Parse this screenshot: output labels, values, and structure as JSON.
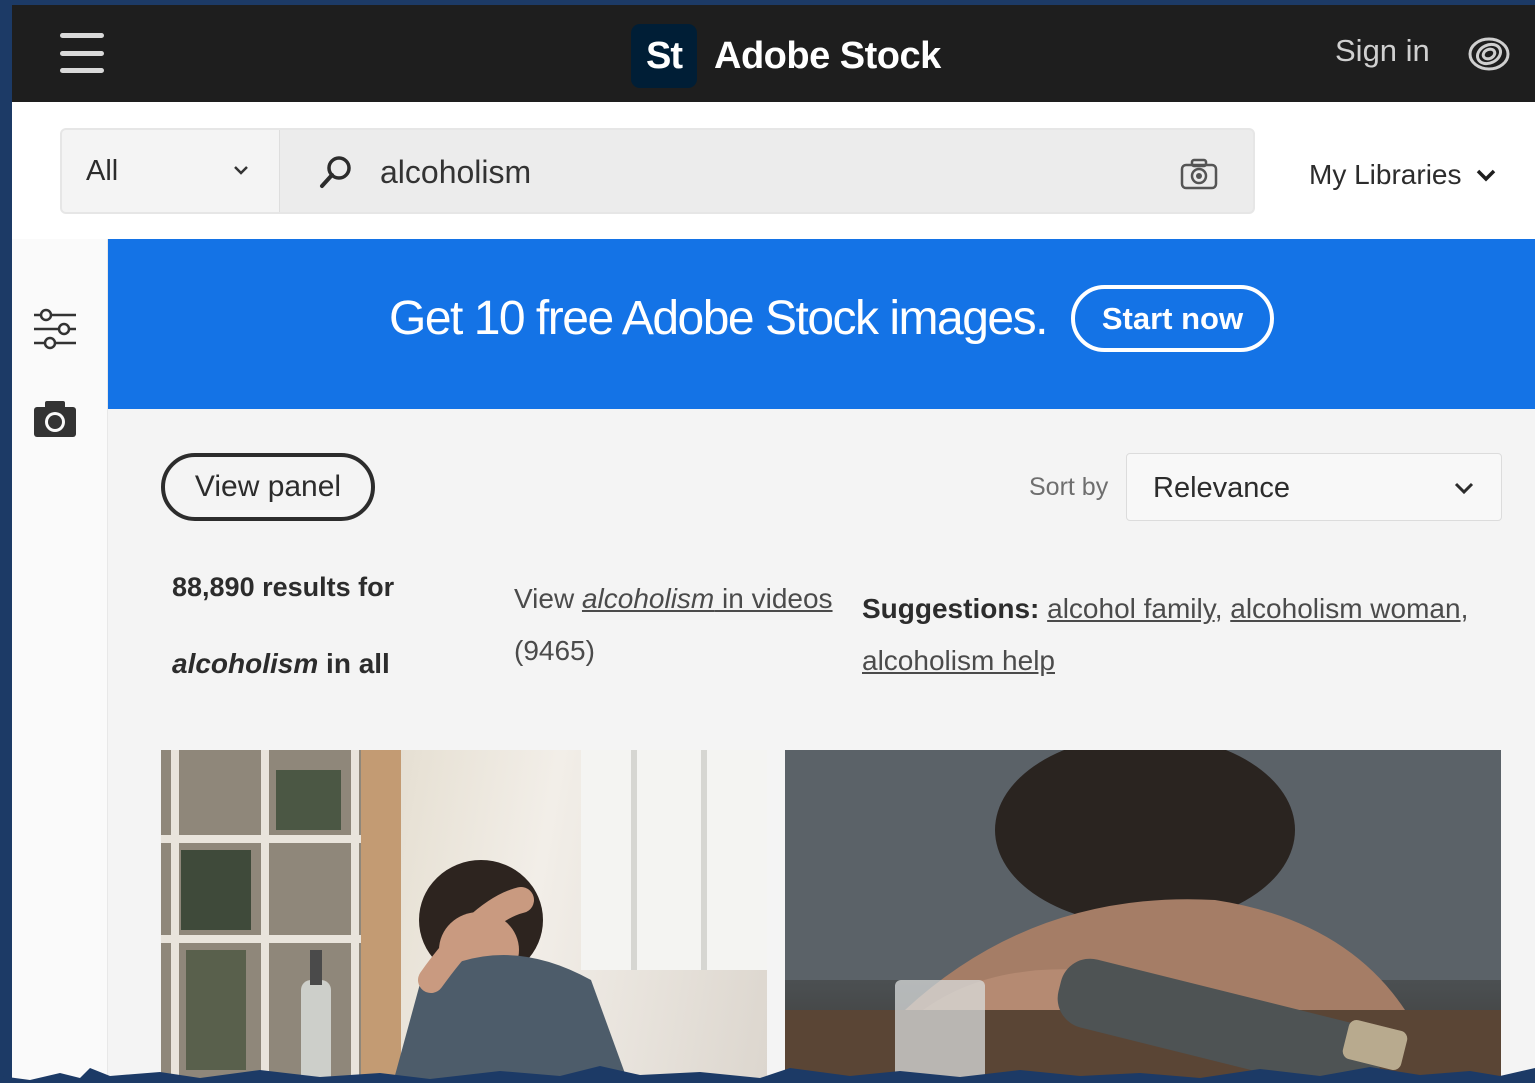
{
  "header": {
    "logo_badge": "St",
    "logo_text": "Adobe Stock",
    "sign_in": "Sign in"
  },
  "search": {
    "scope": "All",
    "query": "alcoholism",
    "my_libraries": "My Libraries"
  },
  "banner": {
    "text": "Get 10 free Adobe Stock images.",
    "cta": "Start now"
  },
  "controls": {
    "view_panel": "View panel",
    "sort_label": "Sort by",
    "sort_value": "Relevance"
  },
  "results": {
    "count_text": "88,890 results for",
    "query": "alcoholism",
    "scope_suffix": " in all",
    "videos_prefix": "View ",
    "videos_query": "alcoholism",
    "videos_suffix": " in videos",
    "videos_count": "(9465)",
    "suggestions_label": "Suggestions:",
    "suggestions": [
      "alcohol family",
      "alcoholism woman",
      "alcoholism help"
    ]
  },
  "colors": {
    "topbar": "#1e1e1e",
    "banner": "#1473e6",
    "logo_badge": "#001e36",
    "page": "#f4f4f4"
  },
  "icons": [
    "menu-icon",
    "creative-cloud-icon",
    "chevron-down-icon",
    "search-icon",
    "camera-icon",
    "filter-icon"
  ]
}
